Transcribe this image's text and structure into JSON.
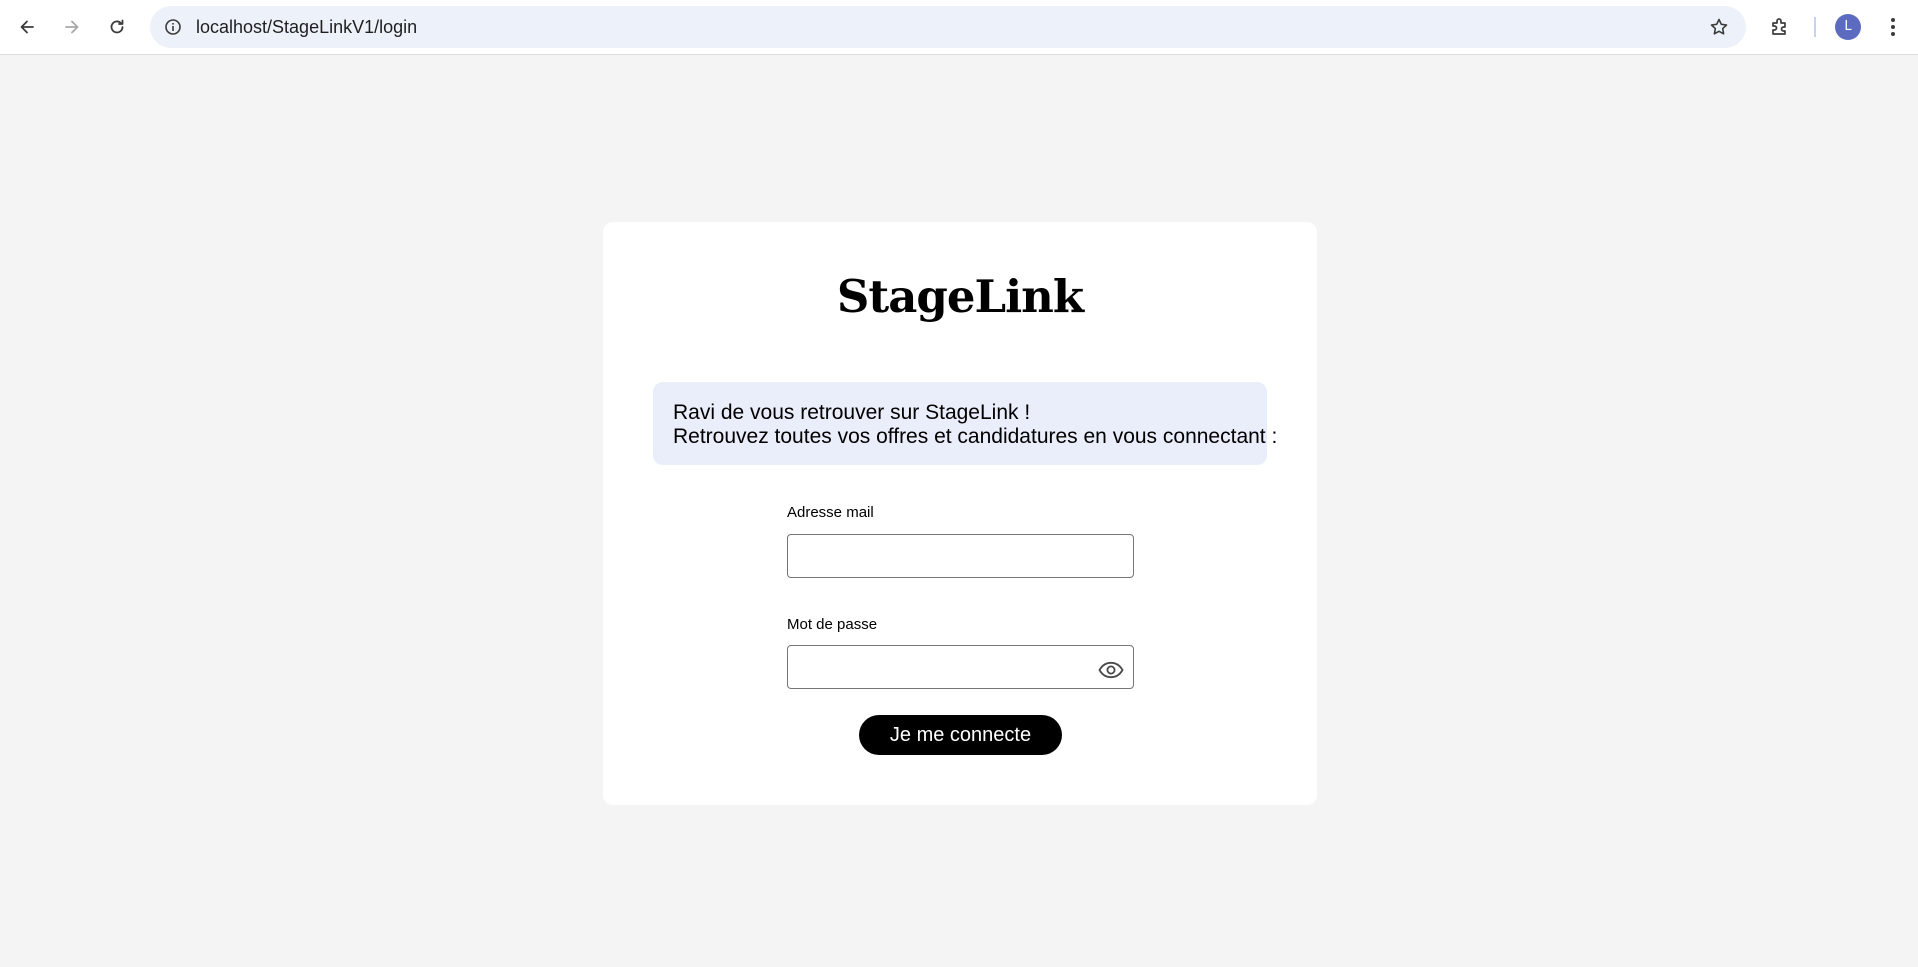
{
  "browser": {
    "url": "localhost/StageLinkV1/login",
    "profile_initial": "L",
    "icons": {
      "back": "arrow-left-icon",
      "forward": "arrow-right-icon",
      "reload": "reload-icon",
      "site_info": "info-icon",
      "bookmark": "star-icon",
      "extensions": "puzzle-icon",
      "menu": "kebab-menu-icon"
    }
  },
  "login": {
    "logo": "StageLink",
    "welcome_line1": "Ravi de vous retrouver sur StageLink !",
    "welcome_line2": "Retrouvez toutes vos offres et candidatures en vous connectant :",
    "email_label": "Adresse mail",
    "email_value": "",
    "password_label": "Mot de passe",
    "password_value": "",
    "password_toggle_icon": "eye-icon",
    "submit_label": "Je me connecte"
  },
  "colors": {
    "page_background": "#f4f4f4",
    "card_background": "#ffffff",
    "welcome_background": "#eaedfa",
    "button_background": "#000000",
    "button_text": "#ffffff",
    "avatar": "#5c6bc0"
  }
}
